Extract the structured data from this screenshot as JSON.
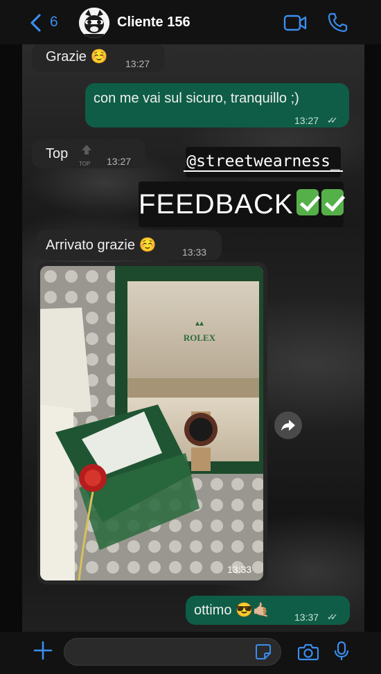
{
  "header": {
    "back_count": "6",
    "contact_name": "Cliente 156"
  },
  "messages": [
    {
      "side": "in",
      "text": "Grazie ☺️",
      "time": "13:27"
    },
    {
      "side": "out",
      "text": "con me vai sul sicuro, tranquillo ;)",
      "time": "13:27",
      "status": "read"
    },
    {
      "side": "in",
      "text": "Top",
      "time": "13:27"
    },
    {
      "side": "in",
      "text": "Arrivato grazie ☺️",
      "time": "13:33"
    },
    {
      "side": "in",
      "type": "photo",
      "time": "13:33",
      "photo_text": "ROLEX"
    },
    {
      "side": "out",
      "text": "ottimo 😎🤙🏼",
      "time": "13:37",
      "status": "read"
    }
  ],
  "overlay": {
    "handle": "@streetwearness_",
    "feedback": "FEEDBACK"
  },
  "small_label": "TOP",
  "colors": {
    "accent": "#3a8ef0",
    "outgoing_bubble": "#0f5d46",
    "incoming_bubble": "#262626"
  }
}
